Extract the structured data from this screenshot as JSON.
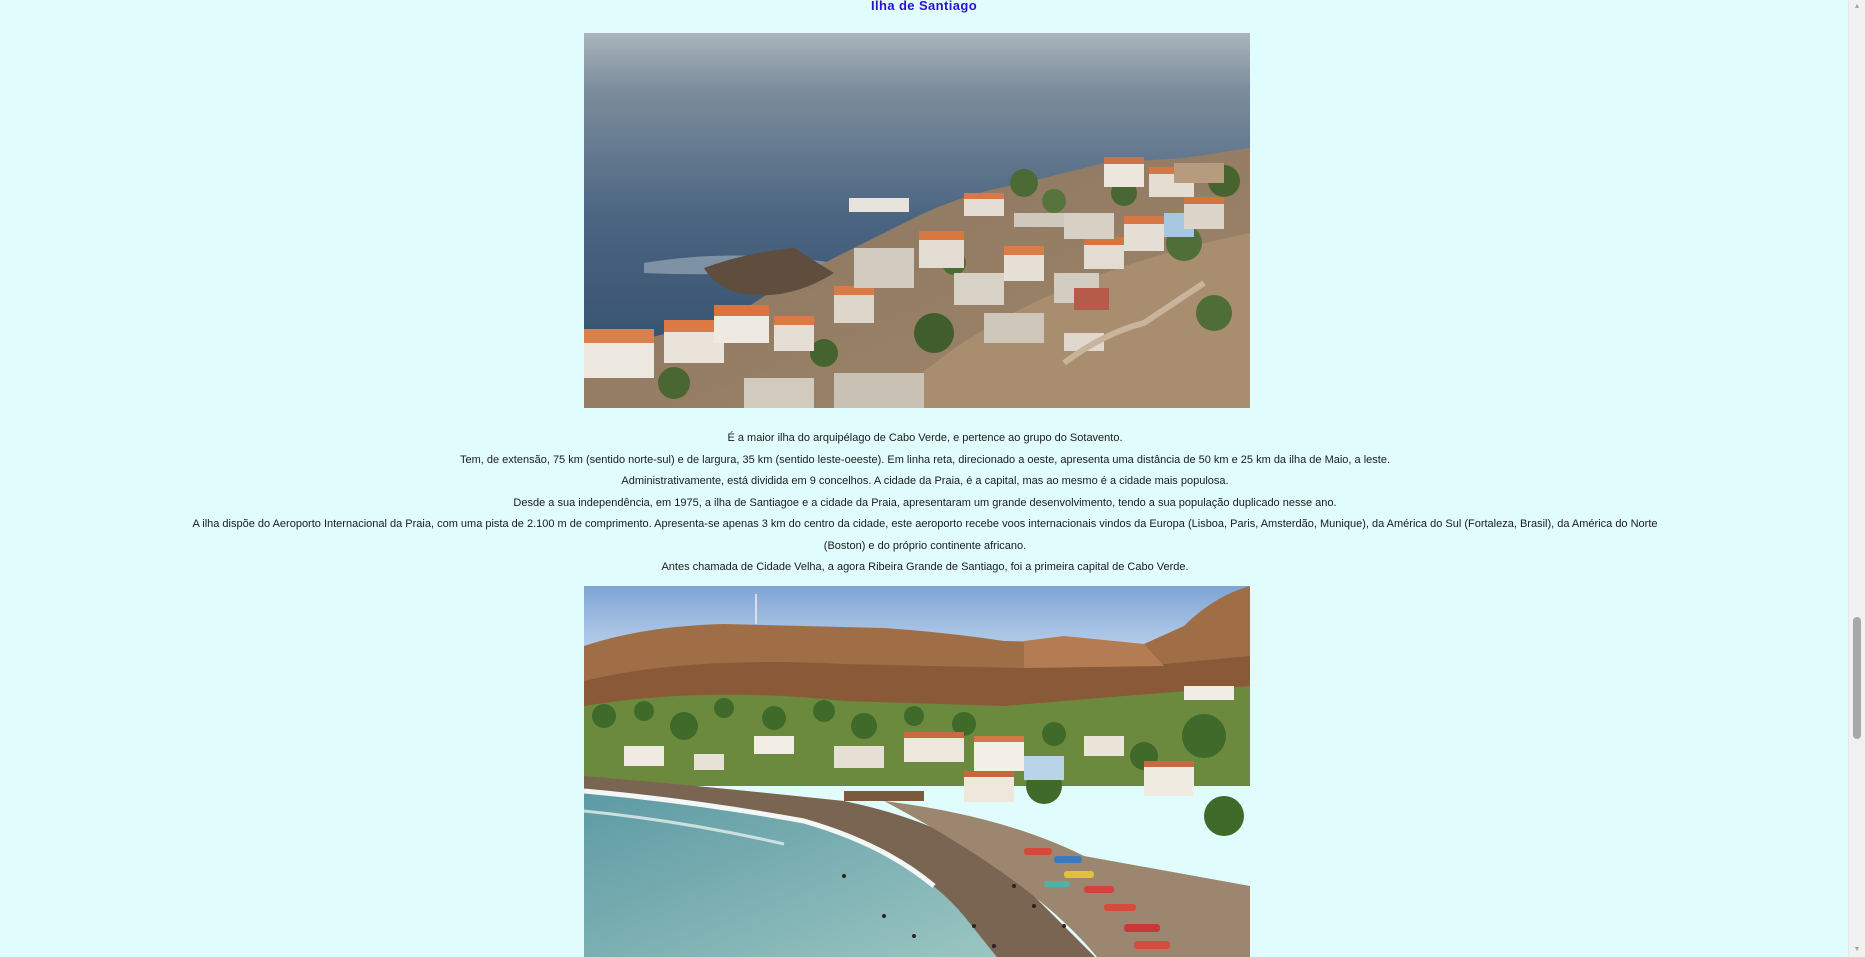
{
  "section": {
    "title": "Ilha de Santiago"
  },
  "images": {
    "top_description": "aerial view of coastal village with white houses and orange roofs on a rocky cliff above the ocean",
    "bottom_description": "beach bay of Cidade Velha with colorful fishing boats, palm trees and a plateau cliff"
  },
  "paragraphs": [
    "É a maior ilha do arquipélago de Cabo Verde, e pertence ao grupo do Sotavento.",
    "Tem, de extensão, 75 km (sentido norte-sul) e de largura, 35 km (sentido leste-oeeste). Em linha reta, direcionado a oeste, apresenta uma distância de 50 km e 25 km da ilha de Maio, a leste.",
    "Administrativamente, está dividida em 9 concelhos. A cidade da Praia, é a capital, mas ao mesmo é a cidade mais populosa.",
    "Desde a sua independência, em 1975, a ilha de Santiagoe e a cidade da Praia, apresentaram um grande desenvolvimento, tendo a sua população duplicado nesse ano.",
    "A ilha dispõe do Aeroporto Internacional da Praia, com uma pista de 2.100 m de comprimento. Apresenta-se apenas 3 km do centro da cidade, este aeroporto recebe voos internacionais vindos da Europa (Lisboa, Paris, Amsterdão, Munique), da América do Sul (Fortaleza, Brasil), da América do Norte (Boston) e do próprio continente africano.",
    "Antes chamada de Cidade Velha, a agora Ribeira Grande de Santiago, foi a primeira capital de Cabo Verde."
  ],
  "scrollbar": {
    "up_icon": "scroll-up-arrow-icon",
    "down_icon": "scroll-down-arrow-icon",
    "position": 0.65
  },
  "colors": {
    "background": "#e1fcfc",
    "title": "#2d0fd0",
    "text": "#1b1b1b"
  }
}
